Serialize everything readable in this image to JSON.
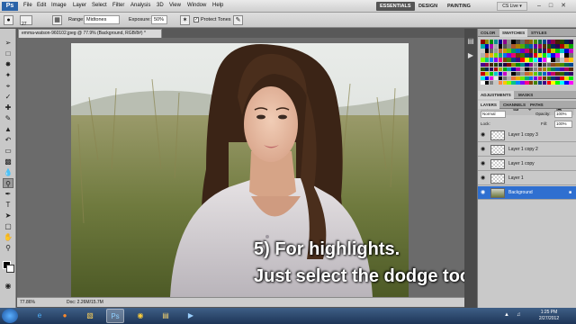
{
  "app": {
    "logo": "Ps",
    "menu": [
      "File",
      "Edit",
      "Image",
      "Layer",
      "Select",
      "Filter",
      "Analysis",
      "3D",
      "View",
      "Window",
      "Help"
    ],
    "workspaces": [
      "ESSENTIALS",
      "DESIGN",
      "PAINTING"
    ],
    "cs_live": "CS Live ▾",
    "window_controls": [
      "–",
      "□",
      "✕"
    ]
  },
  "options_bar": {
    "brush_size": "27",
    "range_label": "Range:",
    "range_value": "Midtones",
    "exposure_label": "Exposure:",
    "exposure_value": "50%",
    "protect_tones_label": "Protect Tones"
  },
  "document": {
    "tab_title": "emma-watson-960102.jpeg @ 77.9% (Background, RGB/8#) *",
    "zoom": "77.86%",
    "doc_info": "Doc: 2.26M/15.7M"
  },
  "caption": {
    "line1": "5) For highlights.",
    "line2": "Just select the dodge tool."
  },
  "panels": {
    "top_tabs": [
      "COLOR",
      "SWATCHES",
      "STYLES"
    ],
    "adjust_tabs": [
      "ADJUSTMENTS",
      "MASKS"
    ],
    "layer_tabs": [
      "LAYERS",
      "CHANNELS",
      "PATHS"
    ],
    "blend_mode": "Normal",
    "opacity_label": "Opacity:",
    "opacity_value": "100%",
    "lock_label": "Lock:",
    "fill_label": "Fill:",
    "fill_value": "100%"
  },
  "layers": [
    {
      "name": "Layer 1 copy 3",
      "selected": false
    },
    {
      "name": "Layer 1 copy 2",
      "selected": false
    },
    {
      "name": "Layer 1 copy",
      "selected": false
    },
    {
      "name": "Layer 1",
      "selected": false
    },
    {
      "name": "Background",
      "selected": true
    }
  ],
  "taskbar": {
    "time": "1:25 PM",
    "date": "2/27/2012",
    "apps": [
      "ie-icon",
      "firefox-icon",
      "explorer-icon",
      "photoshop-icon",
      "chrome-icon",
      "folder-icon",
      "media-player-icon"
    ]
  },
  "colors": {
    "accent": "#2f6fd0",
    "swatches": [
      "#ff0000",
      "#ffff00",
      "#00ff00",
      "#00ffff",
      "#0000ff",
      "#ff00ff",
      "#ffffff",
      "#000000",
      "#808080",
      "#c0c0c0",
      "#ff8040",
      "#ffc000",
      "#80ff00",
      "#00c080",
      "#0080ff",
      "#8000ff",
      "#ff0080",
      "#804000",
      "#408000",
      "#004080",
      "#400080"
    ]
  }
}
